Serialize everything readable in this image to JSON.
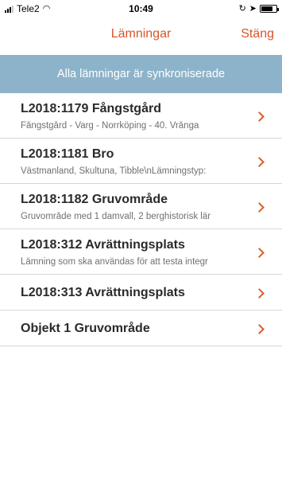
{
  "status_bar": {
    "carrier": "Tele2",
    "time": "10:49"
  },
  "nav": {
    "title": "Lämningar",
    "close_label": "Stäng"
  },
  "sync_banner": {
    "text": "Alla lämningar är synkroniserade"
  },
  "items": [
    {
      "title": "L2018:1179 Fångstgård",
      "subtitle": "Fångstgård - Varg - Norrköping - 40. Vrånga"
    },
    {
      "title": "L2018:1181 Bro",
      "subtitle": "Västmanland, Skultuna, Tibble\\nLämningstyp:"
    },
    {
      "title": "L2018:1182 Gruvområde",
      "subtitle": "Gruvområde med 1 damvall, 2 berghistorisk lär"
    },
    {
      "title": "L2018:312 Avrättningsplats",
      "subtitle": "Lämning som ska användas för att testa integr"
    },
    {
      "title": "L2018:313 Avrättningsplats",
      "subtitle": ""
    },
    {
      "title": "Objekt 1 Gruvområde",
      "subtitle": ""
    }
  ],
  "colors": {
    "accent": "#d9552b",
    "banner": "#8cb3c9"
  }
}
